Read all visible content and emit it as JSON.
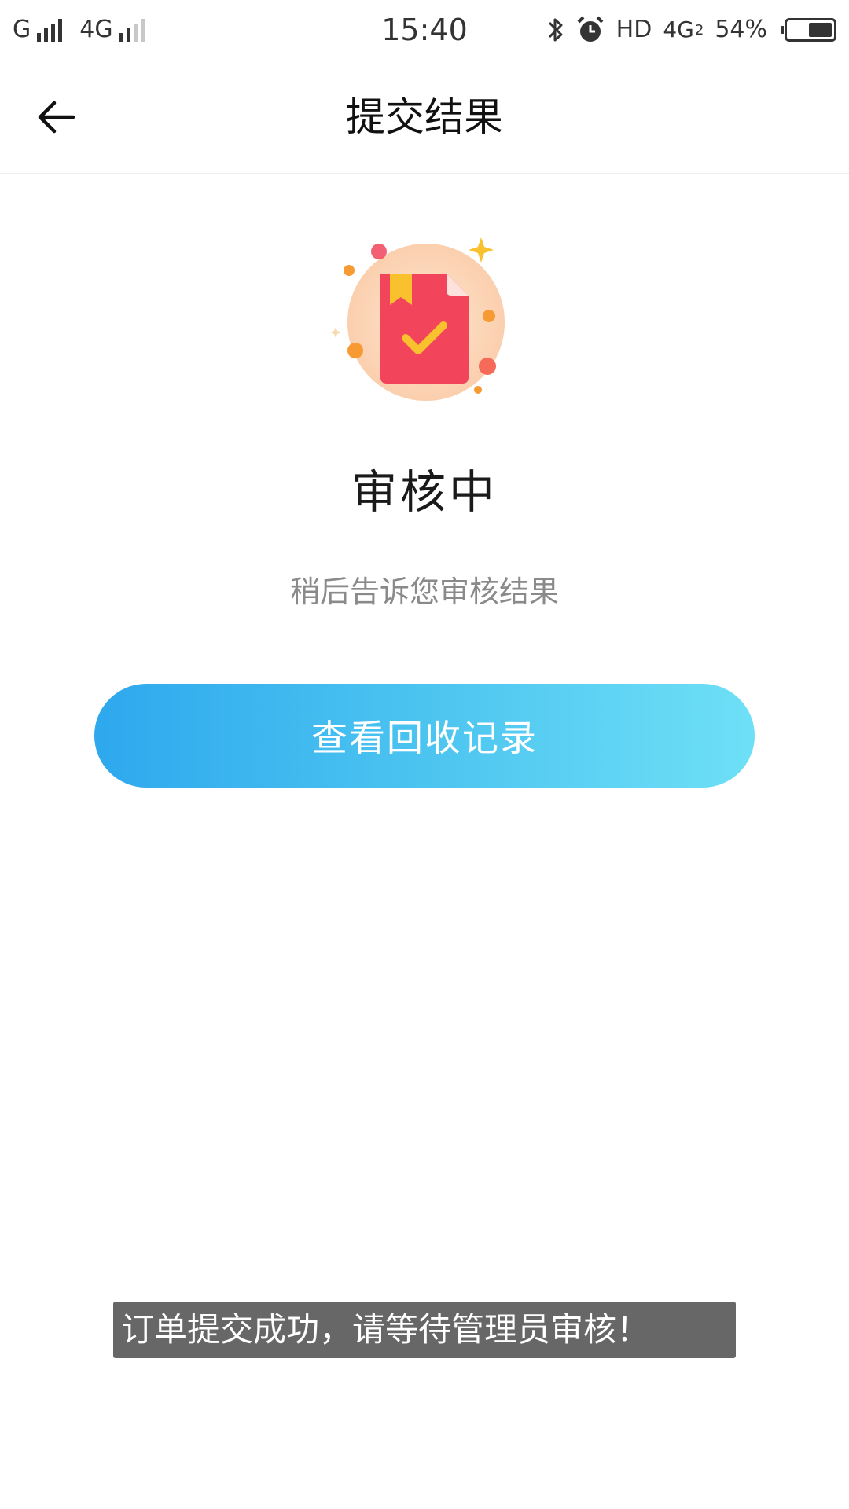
{
  "status_bar": {
    "carrier1": "G",
    "carrier2": "4G",
    "time": "15:40",
    "hd": "HD",
    "network": "4G",
    "network_sub": "2",
    "battery_text": "54%",
    "battery_level": 0.54,
    "icons": [
      "signal-icon",
      "bluetooth-icon",
      "alarm-icon",
      "battery-icon"
    ]
  },
  "nav": {
    "title": "提交结果",
    "back_icon": "arrow-left-icon"
  },
  "status": {
    "illustration": "document-check-icon",
    "title": "审核中",
    "description": "稍后告诉您审核结果"
  },
  "actions": {
    "view_records_label": "查看回收记录"
  },
  "toast": {
    "message": "订单提交成功，请等待管理员审核！"
  },
  "colors": {
    "button_gradient_start": "#2ea8ee",
    "button_gradient_end": "#6ee0f6",
    "doc_red": "#f2445a",
    "doc_yellow": "#f9c12e",
    "illustration_bg": "#fbd9bd",
    "toast_bg": "#5a5a5a"
  }
}
